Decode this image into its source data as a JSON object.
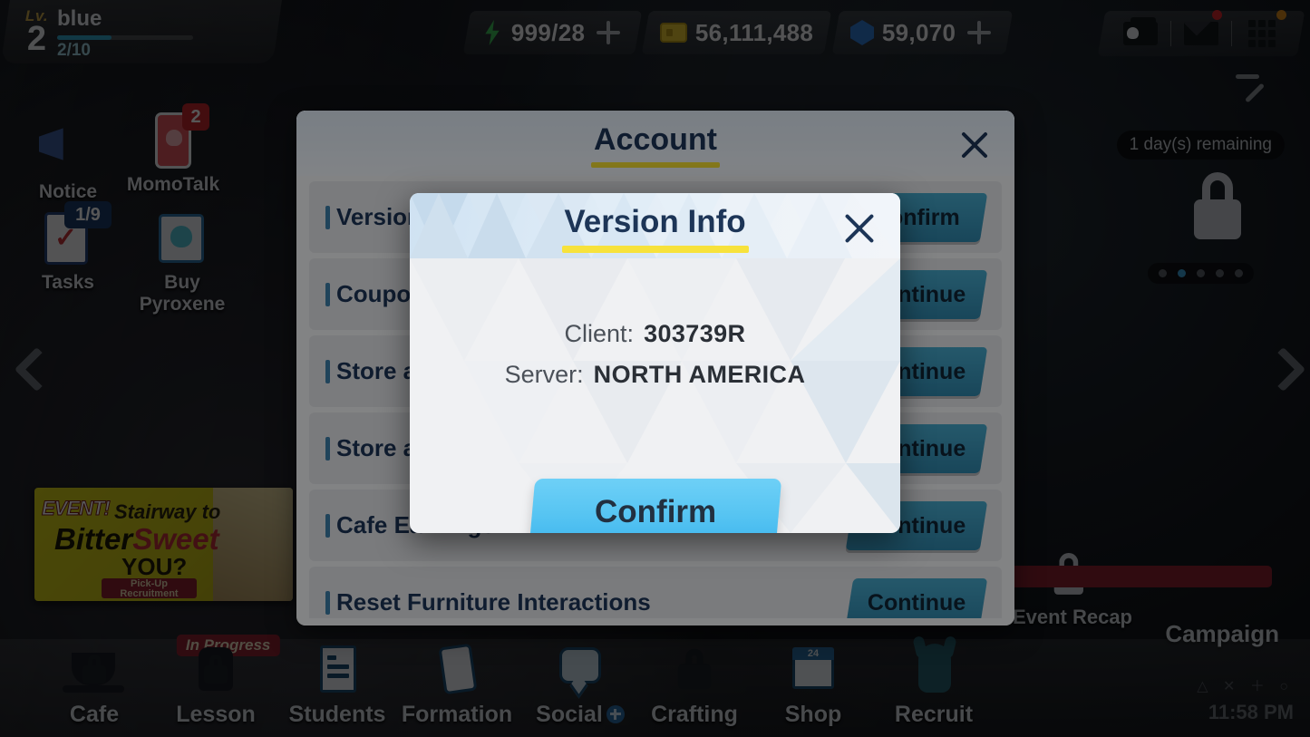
{
  "player": {
    "lv_label": "Lv.",
    "level": "2",
    "name": "blue",
    "xp": "2/10"
  },
  "currencies": [
    {
      "icon": "bolt-icon",
      "value": "999/28",
      "has_plus": true
    },
    {
      "icon": "credit-icon",
      "value": "56,111,488",
      "has_plus": false
    },
    {
      "icon": "pyroxene-icon",
      "value": "59,070",
      "has_plus": true
    }
  ],
  "top_right_icons": [
    {
      "name": "profile-card-icon",
      "dot": ""
    },
    {
      "name": "mail-icon",
      "dot": "red"
    },
    {
      "name": "menu-grid-icon",
      "dot": "orange"
    }
  ],
  "left_menu": [
    {
      "label": "Notice",
      "icon": "megaphone-icon",
      "badge": ""
    },
    {
      "label": "MomoTalk",
      "icon": "phone-icon",
      "badge": "2"
    },
    {
      "label": "Tasks",
      "icon": "clipboard-icon",
      "badge": "1/9"
    },
    {
      "label": "Buy Pyroxene",
      "icon": "shopping-bag-icon",
      "badge": ""
    }
  ],
  "event_banner": {
    "tag": "EVENT!",
    "line1": "Stairway to",
    "line2_a": "Bitter",
    "line2_b": "Sweet",
    "line3": "YOU?",
    "pill_line1": "Pick-Up",
    "pill_line2": "Recruitment"
  },
  "right_panel": {
    "remaining_tag": "1 day(s) remaining",
    "event_recap_label": "Event Recap",
    "campaign_label": "Campaign",
    "campaign_badge": "In Progress"
  },
  "bottom_nav": [
    {
      "label": "Cafe",
      "icon": "coffee-cup-icon",
      "locked": true,
      "badge": ""
    },
    {
      "label": "Lesson",
      "icon": "backpack-icon",
      "locked": true,
      "badge": "In Progress"
    },
    {
      "label": "Students",
      "icon": "student-card-icon",
      "locked": false,
      "badge": ""
    },
    {
      "label": "Formation",
      "icon": "tablet-icon",
      "locked": false,
      "badge": ""
    },
    {
      "label": "Social",
      "icon": "chat-bubble-icon",
      "locked": false,
      "badge": ""
    },
    {
      "label": "Crafting",
      "icon": "craft-lock-icon",
      "locked": true,
      "badge": ""
    },
    {
      "label": "Shop",
      "icon": "shop-icon",
      "locked": false,
      "badge": ""
    },
    {
      "label": "Recruit",
      "icon": "recruit-icon",
      "locked": false,
      "badge": ""
    }
  ],
  "system": {
    "keys": "△ ✕ ＋ ○",
    "clock": "11:58 PM"
  },
  "account_modal": {
    "title": "Account",
    "close_icon": "close-icon",
    "rows": [
      {
        "label": "Version",
        "button": "Confirm"
      },
      {
        "label": "Coupon",
        "button": "Continue"
      },
      {
        "label": "Store a",
        "button": "Continue"
      },
      {
        "label": "Store a",
        "button": "Continue"
      },
      {
        "label": "Cafe Earnings",
        "button": "Continue"
      },
      {
        "label": "Reset Furniture Interactions",
        "button": "Continue"
      }
    ]
  },
  "version_modal": {
    "title": "Version Info",
    "close_icon": "close-icon",
    "client_key": "Client:",
    "client_value": "303739R",
    "server_key": "Server:",
    "server_value": "NORTH AMERICA",
    "confirm_label": "Confirm"
  },
  "colors": {
    "accent_yellow": "#f7e23c",
    "title_navy": "#1d3557",
    "confirm_blue": "#56c4f2",
    "row_button_teal": "#2e82a6"
  }
}
